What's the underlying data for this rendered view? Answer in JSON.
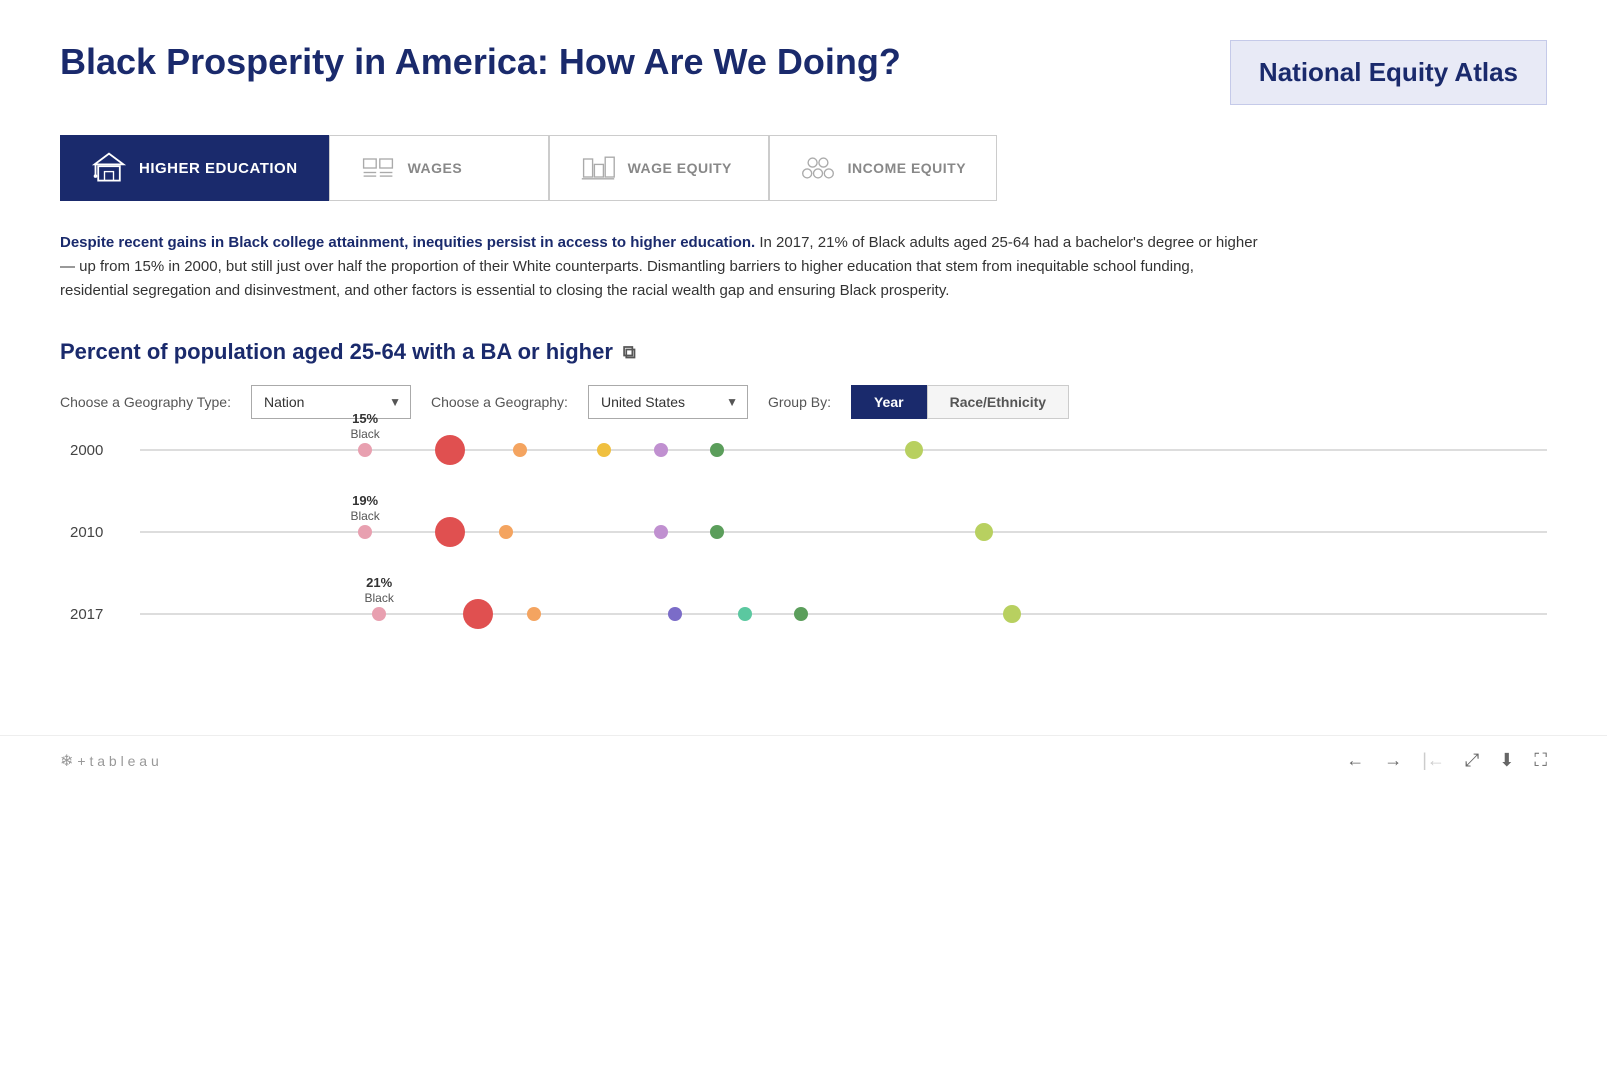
{
  "page": {
    "title": "Black Prosperity in America: How Are We Doing?",
    "atlas_badge": "National Equity Atlas"
  },
  "tabs": [
    {
      "id": "higher-education",
      "label": "HIGHER EDUCATION",
      "active": true
    },
    {
      "id": "wages",
      "label": "WAGES",
      "active": false
    },
    {
      "id": "wage-equity",
      "label": "WAGE EQUITY",
      "active": false
    },
    {
      "id": "income-equity",
      "label": "INCOME EQUITY",
      "active": false
    }
  ],
  "description": {
    "bold_text": "Despite recent gains in Black college attainment, inequities persist in access to higher education.",
    "body_text": " In 2017, 21% of Black adults aged 25-64 had a bachelor's degree or higher — up from 15% in 2000, but still just over half the proportion of their White counterparts. Dismantling barriers to higher education that stem from inequitable school funding, residential segregation and disinvestment, and other factors is essential to closing the racial wealth gap and ensuring Black prosperity."
  },
  "chart": {
    "title": "Percent of population aged 25-64 with a BA or higher",
    "geography_type_label": "Choose a Geography Type:",
    "geography_type_value": "Nation",
    "geography_label": "Choose a Geography:",
    "geography_value": "United States",
    "group_by_label": "Group By:",
    "group_by_options": [
      "Year",
      "Race/Ethnicity"
    ],
    "group_by_active": "Year",
    "years": [
      {
        "year": "2000",
        "dots": [
          {
            "color": "#e8a0b0",
            "size": 14,
            "pos": 16,
            "label": "15%",
            "sublabel": "Black",
            "show_label": true
          },
          {
            "color": "#e05050",
            "size": 30,
            "pos": 22,
            "label": "",
            "sublabel": "",
            "show_label": false
          },
          {
            "color": "#f4a460",
            "size": 14,
            "pos": 27,
            "label": "",
            "sublabel": "",
            "show_label": false
          },
          {
            "color": "#f0c040",
            "size": 14,
            "pos": 33,
            "label": "",
            "sublabel": "",
            "show_label": false
          },
          {
            "color": "#c090d0",
            "size": 14,
            "pos": 37,
            "label": "",
            "sublabel": "",
            "show_label": false
          },
          {
            "color": "#5b9e5b",
            "size": 14,
            "pos": 41,
            "label": "",
            "sublabel": "",
            "show_label": false
          },
          {
            "color": "#b8d060",
            "size": 18,
            "pos": 55,
            "label": "",
            "sublabel": "",
            "show_label": false
          }
        ]
      },
      {
        "year": "2010",
        "dots": [
          {
            "color": "#e8a0b0",
            "size": 14,
            "pos": 16,
            "label": "19%",
            "sublabel": "Black",
            "show_label": true
          },
          {
            "color": "#e05050",
            "size": 30,
            "pos": 22,
            "label": "",
            "sublabel": "",
            "show_label": false
          },
          {
            "color": "#f4a460",
            "size": 14,
            "pos": 26,
            "label": "",
            "sublabel": "",
            "show_label": false
          },
          {
            "color": "#c090d0",
            "size": 14,
            "pos": 37,
            "label": "",
            "sublabel": "",
            "show_label": false
          },
          {
            "color": "#5b9e5b",
            "size": 14,
            "pos": 41,
            "label": "",
            "sublabel": "",
            "show_label": false
          },
          {
            "color": "#b8d060",
            "size": 18,
            "pos": 60,
            "label": "",
            "sublabel": "",
            "show_label": false
          }
        ]
      },
      {
        "year": "2017",
        "dots": [
          {
            "color": "#e8a0b0",
            "size": 14,
            "pos": 17,
            "label": "21%",
            "sublabel": "Black",
            "show_label": true
          },
          {
            "color": "#e05050",
            "size": 30,
            "pos": 24,
            "label": "",
            "sublabel": "",
            "show_label": false
          },
          {
            "color": "#f4a460",
            "size": 14,
            "pos": 28,
            "label": "",
            "sublabel": "",
            "show_label": false
          },
          {
            "color": "#7b6cc8",
            "size": 14,
            "pos": 38,
            "label": "",
            "sublabel": "",
            "show_label": false
          },
          {
            "color": "#5bc8a0",
            "size": 14,
            "pos": 43,
            "label": "",
            "sublabel": "",
            "show_label": false
          },
          {
            "color": "#5b9e5b",
            "size": 14,
            "pos": 47,
            "label": "",
            "sublabel": "",
            "show_label": false
          },
          {
            "color": "#b8d060",
            "size": 18,
            "pos": 62,
            "label": "",
            "sublabel": "",
            "show_label": false
          }
        ]
      }
    ]
  },
  "footer": {
    "tableau_text": "+ t a b l e a u"
  }
}
